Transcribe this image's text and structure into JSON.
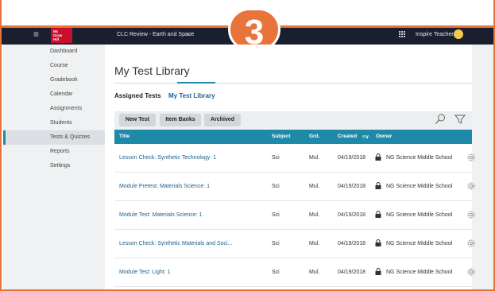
{
  "header": {
    "logo_text": "Mc Graw Hill Education",
    "course_title": "CLC Review - Earth and Space",
    "user_name": "Inspire Teacher",
    "step_number": "3"
  },
  "sidebar": {
    "items": [
      {
        "label": "Dashboard"
      },
      {
        "label": "Course"
      },
      {
        "label": "Gradebook"
      },
      {
        "label": "Calendar"
      },
      {
        "label": "Assignments"
      },
      {
        "label": "Students"
      },
      {
        "label": "Tests & Quizzes",
        "active": true
      },
      {
        "label": "Reports"
      },
      {
        "label": "Settings"
      }
    ]
  },
  "main": {
    "page_title": "My Test Library",
    "tabs": [
      {
        "label": "Assigned Tests"
      },
      {
        "label": "My Test Library",
        "active": true
      }
    ],
    "toolbar": {
      "buttons": [
        {
          "label": "New Test"
        },
        {
          "label": "Item Banks"
        },
        {
          "label": "Archived"
        }
      ]
    },
    "table": {
      "columns": [
        "Title",
        "Subject",
        "Grd.",
        "Created",
        "Owner"
      ],
      "sort_indicator": "≡∨",
      "rows": [
        {
          "title": "Lesson Check: Synthetic Technology: 1",
          "subject": "Sci",
          "grade": "Mul.",
          "created": "04/19/2018",
          "owner": "NG Science Middle School"
        },
        {
          "title": "Module Pretest: Materials Science: 1",
          "subject": "Sci",
          "grade": "Mul.",
          "created": "04/19/2018",
          "owner": "NG Science Middle School"
        },
        {
          "title": "Module Test: Materials Science: 1",
          "subject": "Sci",
          "grade": "Mul.",
          "created": "04/19/2018",
          "owner": "NG Science Middle School"
        },
        {
          "title": "Lesson Check: Synthetic Materials and Soci...",
          "subject": "Sci",
          "grade": "Mul.",
          "created": "04/19/2018",
          "owner": "NG Science Middle School"
        },
        {
          "title": "Module Test: Light: 1",
          "subject": "Sci",
          "grade": "Mul.",
          "created": "04/19/2018",
          "owner": "NG Science Middle School"
        }
      ]
    }
  },
  "colors": {
    "accent": "#1f8aa8",
    "topbar": "#1a1f2e",
    "badge": "#e8743b",
    "link": "#1f5f89"
  }
}
